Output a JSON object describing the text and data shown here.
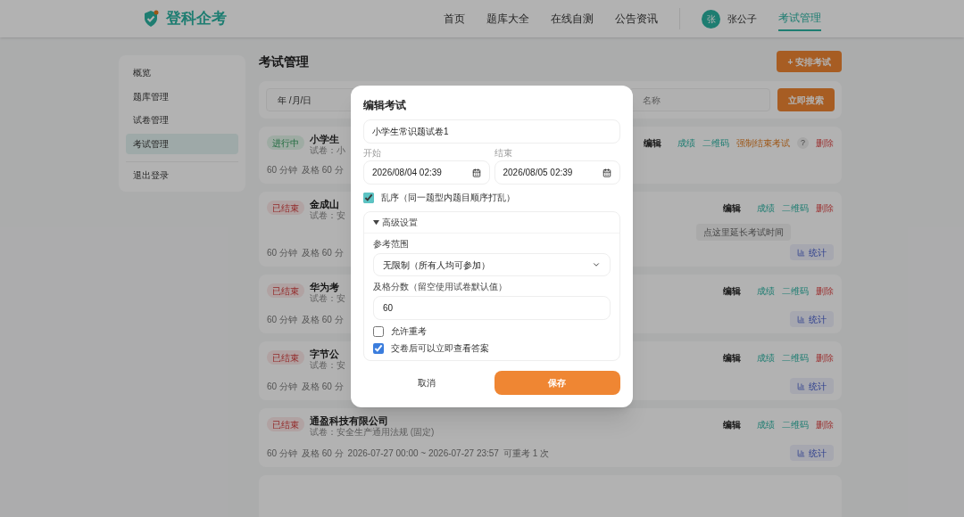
{
  "header": {
    "logo_text": "登科企考",
    "nav": [
      {
        "label": "首页",
        "selected": false
      },
      {
        "label": "题库大全",
        "selected": false
      },
      {
        "label": "在线自测",
        "selected": false
      },
      {
        "label": "公告资讯",
        "selected": false
      }
    ],
    "user": {
      "avatar_text": "张",
      "name": "张公子"
    },
    "current": {
      "label": "考试管理",
      "selected": true
    }
  },
  "sidebar": {
    "items": [
      {
        "label": "概览",
        "selected": false
      },
      {
        "label": "题库管理",
        "selected": false
      },
      {
        "label": "试卷管理",
        "selected": false
      },
      {
        "label": "考试管理",
        "selected": true
      }
    ],
    "logout": "退出登录"
  },
  "page_title": "考试管理",
  "add_button": "+ 安排考试",
  "search": {
    "date_placeholder": "年 /月/日",
    "name_placeholder": "名称",
    "button": "立即搜索"
  },
  "exams": [
    {
      "status": "进行中",
      "kind": "running",
      "title": "小学生",
      "paper": "试卷：小",
      "meta": [
        "60 分钟",
        "及格 60 分"
      ],
      "actions": [
        {
          "label": "编辑",
          "kind": "edit"
        },
        {
          "label": "成绩",
          "kind": "link"
        },
        {
          "label": "二维码",
          "kind": "link"
        },
        {
          "label": "强制结束考试",
          "kind": "warn"
        },
        {
          "label": "?",
          "kind": "help"
        },
        {
          "label": "删除",
          "kind": "danger"
        }
      ]
    },
    {
      "status": "已结束",
      "kind": "ended",
      "title": "金成山",
      "paper": "试卷：安",
      "meta": [
        "60 分钟",
        "及格 60 分"
      ],
      "actions": [
        {
          "label": "编辑",
          "kind": "edit"
        },
        {
          "label": "成绩",
          "kind": "link"
        },
        {
          "label": "二维码",
          "kind": "link"
        },
        {
          "label": "删除",
          "kind": "danger"
        }
      ],
      "tooltip": "点这里延长考试时间",
      "stats_button": "统计"
    },
    {
      "status": "已结束",
      "kind": "ended",
      "title": "华为考",
      "paper": "试卷：安",
      "meta": [
        "60 分钟",
        "及格 60 分"
      ],
      "actions": [
        {
          "label": "编辑",
          "kind": "edit"
        },
        {
          "label": "成绩",
          "kind": "link"
        },
        {
          "label": "二维码",
          "kind": "link"
        },
        {
          "label": "删除",
          "kind": "danger"
        }
      ],
      "stats_button": "统计"
    },
    {
      "status": "已结束",
      "kind": "ended",
      "title": "字节公",
      "paper": "试卷：安",
      "meta": [
        "60 分钟",
        "及格 60 分"
      ],
      "actions": [
        {
          "label": "编辑",
          "kind": "edit"
        },
        {
          "label": "成绩",
          "kind": "link"
        },
        {
          "label": "二维码",
          "kind": "link"
        },
        {
          "label": "删除",
          "kind": "danger"
        }
      ],
      "stats_button": "统计"
    },
    {
      "status": "已结束",
      "kind": "ended",
      "title": "通盈科技有限公司",
      "paper": "试卷：安全生产通用法规 (固定)",
      "meta": [
        "60 分钟",
        "及格 60 分",
        "2026-07-27 00:00 ~ 2026-07-27 23:57",
        "可重考 1 次"
      ],
      "actions": [
        {
          "label": "编辑",
          "kind": "edit"
        },
        {
          "label": "成绩",
          "kind": "link"
        },
        {
          "label": "二维码",
          "kind": "link"
        },
        {
          "label": "删除",
          "kind": "danger"
        }
      ],
      "stats_button": "统计"
    }
  ],
  "modal": {
    "title": "编辑考试",
    "name_value": "小学生常识题试卷1",
    "start_label": "开始",
    "start_value": "2026/08/04 02:39",
    "end_label": "结束",
    "end_value": "2026/08/05 02:39",
    "shuffle": {
      "label": "乱序（同一题型内题目顺序打乱）",
      "checked": true
    },
    "advanced": {
      "label": "高级设置",
      "expanded": true
    },
    "scope_label": "参考范围",
    "scope_value": "无限制（所有人均可参加）",
    "pass_label": "及格分数（留空使用试卷默认值）",
    "pass_value": "60",
    "retake": {
      "label": "允许重考",
      "checked": false
    },
    "show_answer": {
      "label": "交卷后可以立即查看答案",
      "checked": true
    },
    "cancel": "取消",
    "save": "保存"
  }
}
